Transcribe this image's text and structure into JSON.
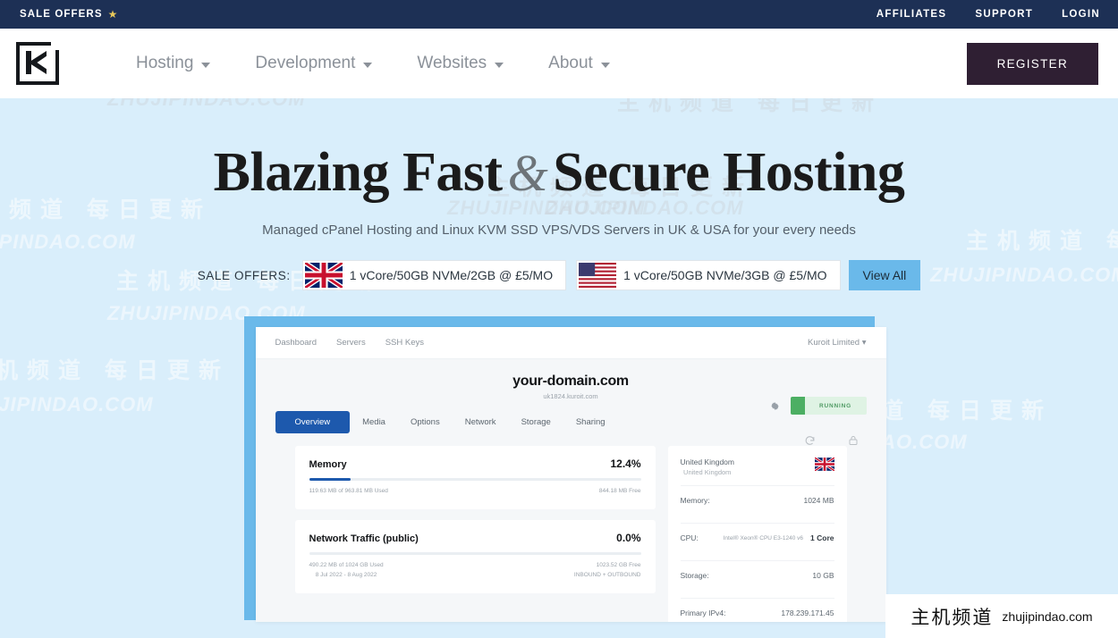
{
  "topbar": {
    "sale_offers_label": "SALE OFFERS",
    "star_icon": "star-icon",
    "links": [
      {
        "label": "AFFILIATES"
      },
      {
        "label": "SUPPORT"
      },
      {
        "label": "LOGIN"
      }
    ]
  },
  "nav": {
    "logo_name": "kuroit-logo",
    "items": [
      {
        "label": "Hosting"
      },
      {
        "label": "Development"
      },
      {
        "label": "Websites"
      },
      {
        "label": "About"
      }
    ],
    "register_label": "REGISTER"
  },
  "hero": {
    "title_part1": "Blazing Fast",
    "title_amp": "&",
    "title_part2": "Secure Hosting",
    "subtitle": "Managed cPanel Hosting and Linux KVM SSD VPS/VDS Servers in UK & USA for your every needs",
    "offers_label": "SALE OFFERS:",
    "offers": [
      {
        "flag": "uk-flag-icon",
        "text": "1 vCore/50GB NVMe/2GB @ £5/MO"
      },
      {
        "flag": "us-flag-icon",
        "text": "1 vCore/50GB NVMe/3GB @ £5/MO"
      }
    ],
    "view_all_label": "View All",
    "accent_color": "#6ab9ea",
    "background_color": "#d9eefb"
  },
  "dashboard": {
    "top_links": [
      {
        "label": "Dashboard"
      },
      {
        "label": "Servers"
      },
      {
        "label": "SSH Keys"
      }
    ],
    "account": "Kuroit Limited ▾",
    "domain": "your-domain.com",
    "hostname": "uk1824.kuroit.com",
    "tabs": [
      {
        "label": "Overview"
      },
      {
        "label": "Media"
      },
      {
        "label": "Options"
      },
      {
        "label": "Network"
      },
      {
        "label": "Storage"
      },
      {
        "label": "Sharing"
      }
    ],
    "status": "RUNNING",
    "gear_icon": "gear-icon",
    "reload_icon": "reload-icon",
    "lock_icon": "lock-icon",
    "cards": [
      {
        "title": "Memory",
        "pct": "12.4%",
        "fill_pct": 12.4,
        "foot_left": "119.63 MB of 963.81 MB Used",
        "foot_left2": "",
        "foot_right": "844.18 MB Free",
        "foot_right2": ""
      },
      {
        "title": "Network Traffic (public)",
        "pct": "0.0%",
        "fill_pct": 0,
        "foot_left": "490.22 MB of 1024 GB Used",
        "foot_left2": "8 Jul 2022 - 8 Aug 2022",
        "foot_right": "1023.52 GB Free",
        "foot_right2": "INBOUND + OUTBOUND"
      }
    ],
    "specs": {
      "country": "United Kingdom",
      "country_sub": "United Kingdom",
      "flag": "uk-flag-icon",
      "rows": [
        {
          "label": "Memory:",
          "mid": "",
          "value": "1024 MB"
        },
        {
          "label": "CPU:",
          "mid": "Intel® Xeon® CPU E3-1240 v6",
          "value": "1 Core"
        },
        {
          "label": "Storage:",
          "mid": "",
          "value": "10 GB"
        },
        {
          "label": "Primary IPv4:",
          "mid": "",
          "value": "178.239.171.45"
        }
      ]
    }
  },
  "watermark": {
    "cn": "主机频道",
    "en": "zhujipindao.com",
    "bg_cn": "主机频道 每日更新",
    "bg_en": "ZHUJIPINDAO.COM"
  }
}
